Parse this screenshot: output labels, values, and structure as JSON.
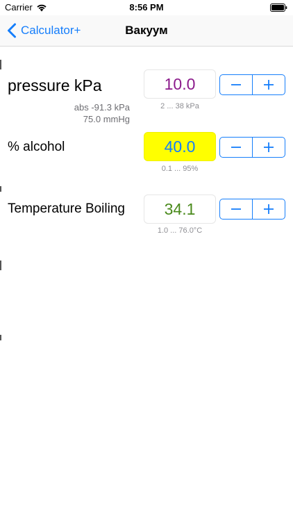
{
  "status_bar": {
    "carrier": "Carrier",
    "time": "8:56 PM"
  },
  "nav": {
    "back_label": "Calculator+",
    "title": "Вакуум"
  },
  "rows": {
    "pressure": {
      "label": "pressure kPa",
      "value": "10.0",
      "range": "2 ... 38 kPa",
      "abs": "abs -91.3 kPa",
      "mmhg": "75.0 mmHg",
      "value_color": "#8b1a8b"
    },
    "alcohol": {
      "label": "% alcohol",
      "value": "40.0",
      "range": "0.1 ... 95%",
      "value_color": "#157efb",
      "highlight_color": "#ffff00"
    },
    "boiling": {
      "label": "Temperature Boiling",
      "value": "34.1",
      "range": "1.0 ... 76.0°C",
      "value_color": "#4a8a1c"
    }
  },
  "colors": {
    "accent": "#157efb"
  },
  "icons": {
    "minus": "minus-icon",
    "plus": "plus-icon",
    "back": "chevron-left-icon",
    "wifi": "wifi-icon",
    "battery": "battery-icon"
  }
}
